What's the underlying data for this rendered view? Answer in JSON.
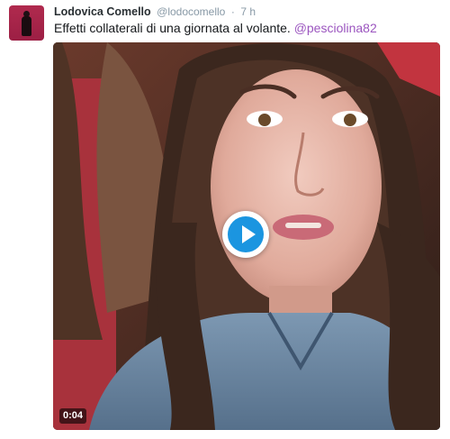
{
  "tweet": {
    "author_name": "Lodovica Comello",
    "author_handle": "@lodocomello",
    "separator": "·",
    "time": "7 h",
    "text": "Effetti collaterali di una giornata al volante.",
    "mention": "@pesciolina82"
  },
  "video": {
    "duration": "0:04",
    "play_icon": "play-icon",
    "accent_color": "#1b95e0"
  },
  "colors": {
    "mention": "#9b55bf",
    "name": "#292f33",
    "meta": "#8899a6"
  }
}
